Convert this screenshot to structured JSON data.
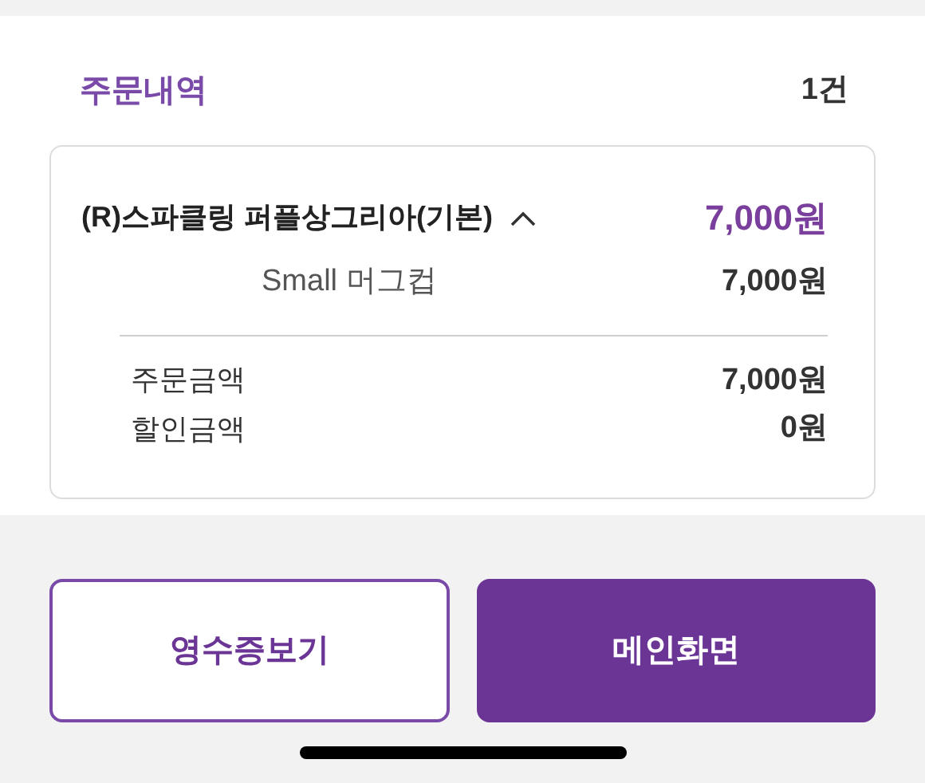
{
  "order_header": {
    "title": "주문내역",
    "count": "1건"
  },
  "items": [
    {
      "name": "(R)스파클링 퍼플상그리아(기본)",
      "expanded": true,
      "price": "7,000원",
      "options": [
        {
          "name": "Small 머그컵",
          "price": "7,000원"
        }
      ]
    }
  ],
  "summary": [
    {
      "label": "주문금액",
      "value": "7,000원"
    },
    {
      "label": "할인금액",
      "value": "0원"
    }
  ],
  "buttons": [
    {
      "label": "영수증보기",
      "kind": "outline"
    },
    {
      "label": "메인화면",
      "kind": "filled"
    }
  ]
}
